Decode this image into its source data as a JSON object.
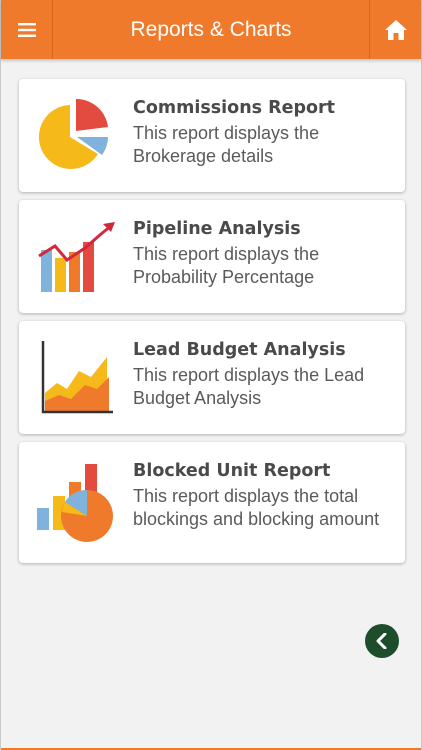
{
  "header": {
    "title": "Reports & Charts",
    "menu_icon": "hamburger-icon",
    "home_icon": "home-icon"
  },
  "reports": [
    {
      "title": "Commissions Report",
      "description": "This report displays the Brokerage details",
      "icon": "pie-chart-icon"
    },
    {
      "title": "Pipeline Analysis",
      "description": "This report displays the Probability Percentage",
      "icon": "bar-trend-chart-icon"
    },
    {
      "title": "Lead Budget Analysis",
      "description": "This report displays the Lead Budget Analysis",
      "icon": "area-chart-icon"
    },
    {
      "title": "Blocked Unit Report",
      "description": "This report displays the total blockings and blocking amount",
      "icon": "bar-pie-chart-icon"
    }
  ],
  "back_button": {
    "icon": "chevron-left-icon"
  },
  "colors": {
    "accent": "#f07a2c",
    "back_button": "#1e4d2b",
    "background": "#f2f2f2"
  }
}
